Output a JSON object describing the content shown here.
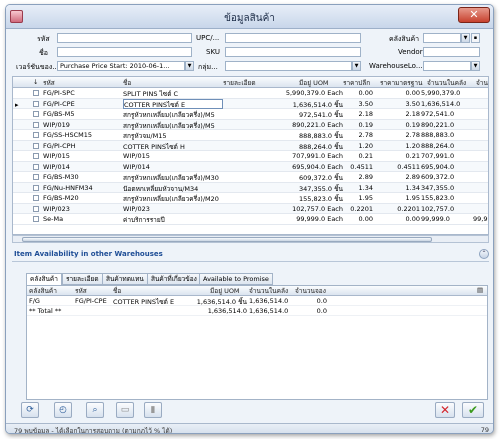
{
  "window": {
    "title": "ข้อมูลสินค้า",
    "close_glyph": "✕"
  },
  "filters": {
    "code_label": "รหัส",
    "code_value": "",
    "upc_label": "UPC/...",
    "upc_value": "",
    "warehouse_label": "คลังสินค้า",
    "warehouse_value": "",
    "name_label": "ชื่อ",
    "name_value": "",
    "sku_label": "SKU",
    "sku_value": "",
    "vendor_label": "Vendor",
    "vendor_value": "",
    "pricelist_label": "เวอร์ชันของ...",
    "pricelist_value": "Purchase Price Start: 2010-06-1...",
    "group_label": "กลุ่ม...",
    "group_value": "",
    "warehouseloc_label": "WarehouseLo...",
    "warehouseloc_value": ""
  },
  "grid": {
    "headers": [
      "รหัส",
      "ชื่อ",
      "รายละเอียด",
      "มีอยู่ UOM",
      "ราคาปลีก",
      "ราคามาตรฐาน",
      "จำนวนในคลัง",
      "จำนวน"
    ],
    "rows": [
      {
        "code": "FG/PI-SPC",
        "name": "SPLIT PINS ไซต์ C",
        "desc": "",
        "qty": "5,990,379.0 Each",
        "list": "0.00",
        "std": "0.00",
        "onhand": "5,990,379.0",
        "extra": ""
      },
      {
        "code": "FG/PI-CPE",
        "name": "COTTER PINSไซต์ E",
        "desc": "",
        "qty": "1,636,514.0 ชิ้น",
        "list": "3.50",
        "std": "3.50",
        "onhand": "1,636,514.0",
        "extra": ""
      },
      {
        "code": "FG/BS-M5",
        "name": "สกรูหัวหกเหลี่ยม(เกลียวครึ่ง)/M5",
        "desc": "",
        "qty": "972,541.0 ชิ้น",
        "list": "2.18",
        "std": "2.18",
        "onhand": "972,541.0",
        "extra": ""
      },
      {
        "code": "WIP/019",
        "name": "สกรูหัวหกเหลี่ยม(เกลียวครึ่ง)/M5",
        "desc": "",
        "qty": "890,221.0 Each",
        "list": "0.19",
        "std": "0.19",
        "onhand": "890,221.0",
        "extra": ""
      },
      {
        "code": "FG/SS-HSCM15",
        "name": "สกรูหัวจม/M15",
        "desc": "",
        "qty": "888,883.0 ชิ้น",
        "list": "2.78",
        "std": "2.78",
        "onhand": "888,883.0",
        "extra": ""
      },
      {
        "code": "FG/PI-CPH",
        "name": "COTTER PINSไซต์ H",
        "desc": "",
        "qty": "888,264.0 ชิ้น",
        "list": "1.20",
        "std": "1.20",
        "onhand": "888,264.0",
        "extra": ""
      },
      {
        "code": "WIP/015",
        "name": "WIP/015",
        "desc": "",
        "qty": "707,991.0 Each",
        "list": "0.21",
        "std": "0.21",
        "onhand": "707,991.0",
        "extra": ""
      },
      {
        "code": "WIP/014",
        "name": "WIP/014",
        "desc": "",
        "qty": "695,904.0 Each",
        "list": "0.4511",
        "std": "0.4511",
        "onhand": "695,904.0",
        "extra": ""
      },
      {
        "code": "FG/BS-M30",
        "name": "สกรูหัวหกเหลี่ยม(เกลียวครึ่ง)/M30",
        "desc": "",
        "qty": "609,372.0 ชิ้น",
        "list": "2.89",
        "std": "2.89",
        "onhand": "609,372.0",
        "extra": ""
      },
      {
        "code": "FG/Nu-HNFM34",
        "name": "น๊อตหกเหลี่ยมหัวจาน/M34",
        "desc": "",
        "qty": "347,355.0 ชิ้น",
        "list": "1.34",
        "std": "1.34",
        "onhand": "347,355.0",
        "extra": ""
      },
      {
        "code": "FG/BS-M20",
        "name": "สกรูหัวหกเหลี่ยม(เกลียวครึ่ง)/M20",
        "desc": "",
        "qty": "155,823.0 ชิ้น",
        "list": "1.95",
        "std": "1.95",
        "onhand": "155,823.0",
        "extra": ""
      },
      {
        "code": "WIP/023",
        "name": "WIP/023",
        "desc": "",
        "qty": "102,757.0 Each",
        "list": "0.2201",
        "std": "0.2201",
        "onhand": "102,757.0",
        "extra": ""
      },
      {
        "code": "Se-Ma",
        "name": "ค่าบริการรายปี",
        "desc": "",
        "qty": "99,999.0 Each",
        "list": "0.00",
        "std": "0.00",
        "onhand": "99,999.0",
        "extra": "99,99"
      }
    ],
    "selected_index": 1
  },
  "availability": {
    "title": "Item Availability in other Warehouses",
    "collapse_glyph": "⌃",
    "tabs": [
      "คลังสินค้า",
      "รายละเอียด",
      "สินค้าทดแทน",
      "สินค้าที่เกี่ยวข้อง",
      "Available to Promise"
    ],
    "active_tab": 0,
    "headers": [
      "คลังสินค้า",
      "รหัส",
      "ชื่อ",
      "มีอยู่ UOM",
      "จำนวนในคลัง",
      "จำนวนจอง"
    ],
    "rows": [
      {
        "wh": "F/G",
        "code": "FG/PI-CPE",
        "name": "COTTER PINSไซต์ E",
        "qty": "1,636,514.0 ชิ้น",
        "onhand": "1,636,514.0",
        "reserved": "0.0"
      },
      {
        "wh": "** Total **",
        "code": "",
        "name": "",
        "qty": "1,636,514.0",
        "onhand": "1,636,514.0",
        "reserved": "0.0"
      }
    ]
  },
  "buttons": {
    "refresh": "⟳",
    "history": "◴",
    "zoom": "⌕",
    "print": "▭",
    "delete": "▮",
    "cancel": "✕",
    "ok": "✔"
  },
  "status": {
    "text": "79 พบข้อมูล - ได้เลือกในการสอบถาม (ตามกฎไว้ % ได้)",
    "count": "79"
  }
}
